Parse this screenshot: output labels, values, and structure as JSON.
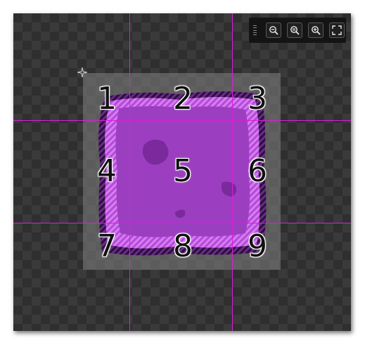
{
  "editor": {
    "slice_labels": [
      "1",
      "2",
      "3",
      "4",
      "5",
      "6",
      "7",
      "8",
      "9"
    ],
    "guide_color": "#d81fd8",
    "sprite_color": "#9b3fc0",
    "sprite_edge_color": "#d36ef0",
    "sprite_outline_color": "#3a1550"
  },
  "toolbar": {
    "buttons": [
      {
        "name": "zoom-out-icon"
      },
      {
        "name": "zoom-reset-icon"
      },
      {
        "name": "zoom-in-icon"
      },
      {
        "name": "fullscreen-icon"
      }
    ]
  }
}
